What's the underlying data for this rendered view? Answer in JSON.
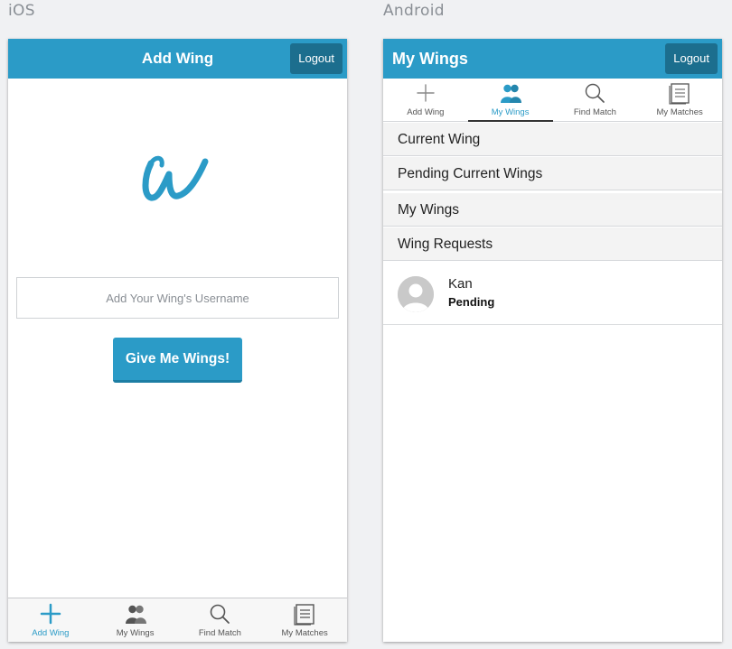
{
  "labels": {
    "ios": "iOS",
    "android": "Android"
  },
  "ios": {
    "title": "Add Wing",
    "logout_label": "Logout",
    "logo_letter": "W",
    "username_placeholder": "Add Your Wing's Username",
    "submit_label": "Give Me Wings!",
    "tabs": [
      {
        "label": "Add Wing",
        "icon": "plus-icon",
        "active": true
      },
      {
        "label": "My Wings",
        "icon": "people-icon",
        "active": false
      },
      {
        "label": "Find Match",
        "icon": "search-icon",
        "active": false
      },
      {
        "label": "My Matches",
        "icon": "document-icon",
        "active": false
      }
    ]
  },
  "android": {
    "title": "My Wings",
    "logout_label": "Logout",
    "tabs": [
      {
        "label": "Add Wing",
        "icon": "plus-icon",
        "active": false
      },
      {
        "label": "My Wings",
        "icon": "people-icon",
        "active": true
      },
      {
        "label": "Find Match",
        "icon": "search-icon",
        "active": false
      },
      {
        "label": "My Matches",
        "icon": "document-icon",
        "active": false
      }
    ],
    "sections": [
      "Current Wing",
      "Pending Current Wings",
      "My Wings",
      "Wing Requests"
    ],
    "requests": [
      {
        "name": "Kan",
        "status": "Pending"
      }
    ]
  },
  "colors": {
    "accent": "#2b9bc7",
    "accent_dark": "#1c6e8e",
    "background": "#f0f1f3"
  }
}
